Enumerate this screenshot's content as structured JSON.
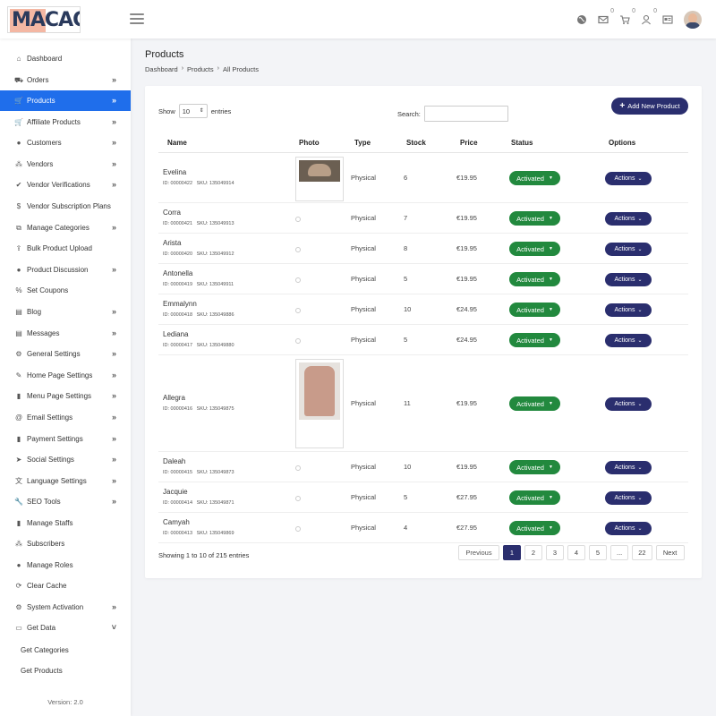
{
  "header": {
    "logo_text": "MACAO",
    "counts": {
      "messages": "0",
      "cart": "0",
      "users": "0"
    }
  },
  "sidebar": {
    "items": [
      {
        "label": "Dashboard",
        "icon": "home-icon",
        "chevron": ""
      },
      {
        "label": "Orders",
        "icon": "hand-cart-icon",
        "chevron": "»"
      },
      {
        "label": "Products",
        "icon": "cart-icon",
        "chevron": "»",
        "active": true
      },
      {
        "label": "Affiliate Products",
        "icon": "cart-icon",
        "chevron": "»"
      },
      {
        "label": "Customers",
        "icon": "user-icon",
        "chevron": "»"
      },
      {
        "label": "Vendors",
        "icon": "users-icon",
        "chevron": "»"
      },
      {
        "label": "Vendor Verifications",
        "icon": "check-icon",
        "chevron": "»"
      },
      {
        "label": "Vendor Subscription Plans",
        "icon": "dollar-icon",
        "chevron": ""
      },
      {
        "label": "Manage Categories",
        "icon": "sitemap-icon",
        "chevron": "»"
      },
      {
        "label": "Bulk Product Upload",
        "icon": "upload-icon",
        "chevron": ""
      },
      {
        "label": "Product Discussion",
        "icon": "comment-icon",
        "chevron": "»"
      },
      {
        "label": "Set Coupons",
        "icon": "percent-icon",
        "chevron": ""
      },
      {
        "label": "Blog",
        "icon": "blog-icon",
        "chevron": "»"
      },
      {
        "label": "Messages",
        "icon": "messages-icon",
        "chevron": "»"
      },
      {
        "label": "General Settings",
        "icon": "cogs-icon",
        "chevron": "»"
      },
      {
        "label": "Home Page Settings",
        "icon": "edit-icon",
        "chevron": "»"
      },
      {
        "label": "Menu Page Settings",
        "icon": "file-icon",
        "chevron": "»"
      },
      {
        "label": "Email Settings",
        "icon": "at-icon",
        "chevron": "»"
      },
      {
        "label": "Payment Settings",
        "icon": "file-icon",
        "chevron": "»"
      },
      {
        "label": "Social Settings",
        "icon": "paper-plane-icon",
        "chevron": "»"
      },
      {
        "label": "Language Settings",
        "icon": "language-icon",
        "chevron": "»"
      },
      {
        "label": "SEO Tools",
        "icon": "wrench-icon",
        "chevron": "»"
      },
      {
        "label": "Manage Staffs",
        "icon": "staff-icon",
        "chevron": ""
      },
      {
        "label": "Subscribers",
        "icon": "users-icon",
        "chevron": ""
      },
      {
        "label": "Manage Roles",
        "icon": "user-cog-icon",
        "chevron": ""
      },
      {
        "label": "Clear Cache",
        "icon": "sync-icon",
        "chevron": ""
      },
      {
        "label": "System Activation",
        "icon": "gear-icon",
        "chevron": "»"
      },
      {
        "label": "Get Data",
        "icon": "desktop-icon",
        "chevron": "˅"
      }
    ],
    "sub_items": [
      {
        "label": "Get Categories"
      },
      {
        "label": "Get Products"
      }
    ],
    "version": "Version: 2.0"
  },
  "page": {
    "title": "Products",
    "breadcrumb": [
      "Dashboard",
      "Products",
      "All Products"
    ],
    "breadcrumb_sep": "›"
  },
  "controls": {
    "show_label": "Show",
    "entries_value": "10",
    "entries_label": "entries",
    "search_label": "Search:",
    "search_value": "",
    "add_button": "Add New Product"
  },
  "table": {
    "columns": [
      "Name",
      "Photo",
      "Type",
      "Stock",
      "Price",
      "Status",
      "Options"
    ],
    "rows": [
      {
        "name": "Evelina",
        "id": "ID: 00000422",
        "sku": "SKU: 135049914",
        "type": "Physical",
        "stock": "6",
        "price": "€19.95",
        "status": "Activated",
        "action": "Actions",
        "photo": "small"
      },
      {
        "name": "Corra",
        "id": "ID: 00000421",
        "sku": "SKU: 135049913",
        "type": "Physical",
        "stock": "7",
        "price": "€19.95",
        "status": "Activated",
        "action": "Actions",
        "photo": "none"
      },
      {
        "name": "Arista",
        "id": "ID: 00000420",
        "sku": "SKU: 135049912",
        "type": "Physical",
        "stock": "8",
        "price": "€19.95",
        "status": "Activated",
        "action": "Actions",
        "photo": "none"
      },
      {
        "name": "Antonella",
        "id": "ID: 00000419",
        "sku": "SKU: 135049911",
        "type": "Physical",
        "stock": "5",
        "price": "€19.95",
        "status": "Activated",
        "action": "Actions",
        "photo": "none"
      },
      {
        "name": "Emmalynn",
        "id": "ID: 00000418",
        "sku": "SKU: 135049886",
        "type": "Physical",
        "stock": "10",
        "price": "€24.95",
        "status": "Activated",
        "action": "Actions",
        "photo": "none"
      },
      {
        "name": "Lediana",
        "id": "ID: 00000417",
        "sku": "SKU: 135049880",
        "type": "Physical",
        "stock": "5",
        "price": "€24.95",
        "status": "Activated",
        "action": "Actions",
        "photo": "none"
      },
      {
        "name": "Allegra",
        "id": "ID: 00000416",
        "sku": "SKU: 135049875",
        "type": "Physical",
        "stock": "11",
        "price": "€19.95",
        "status": "Activated",
        "action": "Actions",
        "photo": "large"
      },
      {
        "name": "Daleah",
        "id": "ID: 00000415",
        "sku": "SKU: 135049873",
        "type": "Physical",
        "stock": "10",
        "price": "€19.95",
        "status": "Activated",
        "action": "Actions",
        "photo": "none"
      },
      {
        "name": "Jacquie",
        "id": "ID: 00000414",
        "sku": "SKU: 135049871",
        "type": "Physical",
        "stock": "5",
        "price": "€27.95",
        "status": "Activated",
        "action": "Actions",
        "photo": "none"
      },
      {
        "name": "Camyah",
        "id": "ID: 00000413",
        "sku": "SKU: 135049869",
        "type": "Physical",
        "stock": "4",
        "price": "€27.95",
        "status": "Activated",
        "action": "Actions",
        "photo": "none"
      }
    ]
  },
  "footer": {
    "info": "Showing 1 to 10 of 215 entries",
    "pages": [
      "Previous",
      "1",
      "2",
      "3",
      "4",
      "5",
      "...",
      "22",
      "Next"
    ],
    "current_page": "1"
  },
  "colors": {
    "primary": "#1f6eeb",
    "navy": "#2a2e6e",
    "success": "#22893e"
  }
}
